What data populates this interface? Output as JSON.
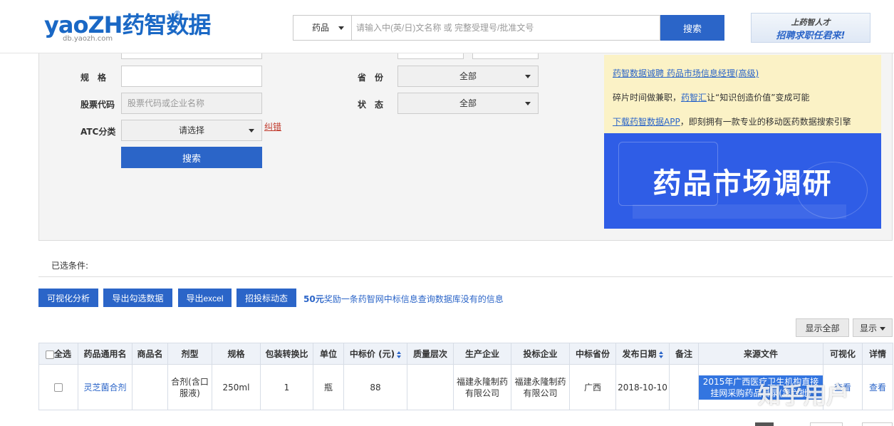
{
  "header": {
    "logo_main": "yaoZH药智数据",
    "logo_sub": "db.yaozh.com",
    "logo_reg": "®",
    "search_type": "药品",
    "search_placeholder": "请输入中(英/日)文名称 或 完整受理号/批准文号",
    "search_button": "搜索",
    "banner_line1": "上药智人才",
    "banner_line2": "招聘求职任君来!"
  },
  "filters": {
    "spec_label": "规　格",
    "spec_value": "",
    "stock_label": "股票代码",
    "stock_placeholder": "股票代码或企业名称",
    "atc_label": "ATC分类",
    "atc_value": "请选择",
    "correct_link": "纠错",
    "province_label": "省　份",
    "province_value": "全部",
    "status_label": "状　态",
    "status_value": "全部",
    "search_button": "搜索"
  },
  "notice": {
    "line1_link": "药智数据诚聘 药品市场信息经理(高级)",
    "line2_pre": "碎片时间做兼职，",
    "line2_link": "药智汇",
    "line2_post": "让“知识创造价值”变成可能",
    "line3_link": "下载药智数据APP",
    "line3_post": "，即刻拥有一款专业的移动医药数据搜索引擎"
  },
  "ad": {
    "title": "药品市场调研"
  },
  "selected": {
    "label": "已选条件:"
  },
  "actions": {
    "visual": "可视化分析",
    "export_selected": "导出勾选数据",
    "export_excel": "导出excel",
    "bidding": "招投标动态",
    "promo_bold": "50元",
    "promo_text": "奖励一条药智网中标信息查询数据库没有的信息",
    "show_all": "显示全部",
    "display": "显示"
  },
  "table": {
    "headers": {
      "select_all": "全选",
      "generic_name": "药品通用名",
      "trade_name": "商品名",
      "dosage_form": "剂型",
      "spec": "规格",
      "pack_ratio": "包装转换比",
      "unit": "单位",
      "bid_price": "中标价 (元)",
      "quality": "质量层次",
      "manufacturer": "生产企业",
      "bidder": "投标企业",
      "province": "中标省份",
      "publish_date": "发布日期",
      "note": "备注",
      "source": "来源文件",
      "visual": "可视化",
      "detail": "详情"
    },
    "rows": [
      {
        "generic_name": "灵芝菌合剂",
        "trade_name": "",
        "dosage_form": "合剂(含口服液)",
        "spec": "250ml",
        "pack_ratio": "1",
        "unit": "瓶",
        "bid_price": "88",
        "quality": "",
        "manufacturer": "福建永隆制药有限公司",
        "bidder": "福建永隆制药有限公司",
        "province": "广西",
        "publish_date": "2018-10-10",
        "note": "",
        "source": "2015年广西医疗卫生机构直接挂网采购药品目录(第六批)",
        "visual": "查看",
        "detail": "查看"
      }
    ]
  },
  "watermark": "知乎用户"
}
